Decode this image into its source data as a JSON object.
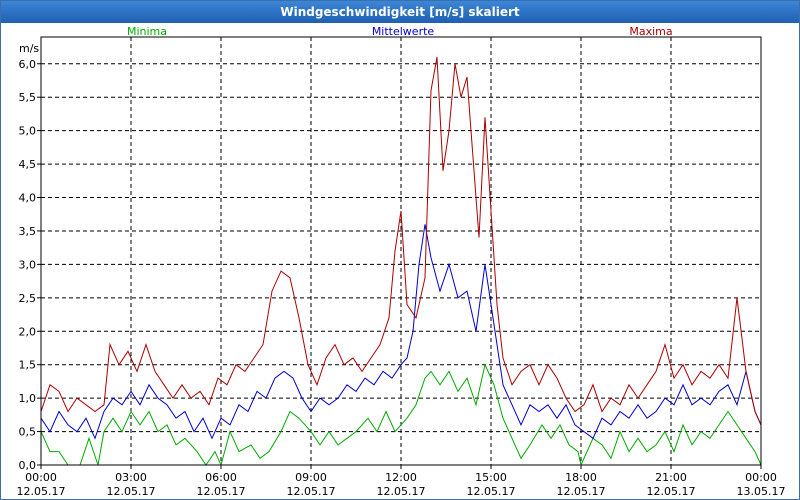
{
  "window": {
    "title": "Windgeschwindigkeit [m/s] skaliert"
  },
  "chart_data": {
    "type": "line",
    "title": "Windgeschwindigkeit [m/s] skaliert",
    "ylabel": "m/s",
    "xlabel": "",
    "ylim": [
      0,
      6.4
    ],
    "xlim": [
      0,
      24
    ],
    "grid": true,
    "legend_position": "top",
    "y_ticks": [
      "0,0",
      "0,5",
      "1,0",
      "1,5",
      "2,0",
      "2,5",
      "3,0",
      "3,5",
      "4,0",
      "4,5",
      "5,0",
      "5,5",
      "6,0"
    ],
    "x_ticks": [
      {
        "time": "00:00",
        "date": "12.05.17"
      },
      {
        "time": "03:00",
        "date": "12.05.17"
      },
      {
        "time": "06:00",
        "date": "12.05.17"
      },
      {
        "time": "09:00",
        "date": "12.05.17"
      },
      {
        "time": "12:00",
        "date": "12.05.17"
      },
      {
        "time": "15:00",
        "date": "12.05.17"
      },
      {
        "time": "18:00",
        "date": "12.05.17"
      },
      {
        "time": "21:00",
        "date": "12.05.17"
      },
      {
        "time": "00:00",
        "date": "13.05.17"
      }
    ],
    "x_unit": "hours since 12.05.17 00:00",
    "series": [
      {
        "name": "Minima",
        "color": "#00aa00",
        "points": [
          [
            0,
            0.5
          ],
          [
            0.3,
            0.2
          ],
          [
            0.6,
            0.2
          ],
          [
            0.9,
            0.0
          ],
          [
            1.3,
            0.0
          ],
          [
            1.6,
            0.4
          ],
          [
            1.9,
            0.0
          ],
          [
            2.1,
            0.5
          ],
          [
            2.4,
            0.7
          ],
          [
            2.7,
            0.5
          ],
          [
            3.0,
            0.8
          ],
          [
            3.3,
            0.6
          ],
          [
            3.6,
            0.8
          ],
          [
            3.9,
            0.5
          ],
          [
            4.2,
            0.6
          ],
          [
            4.5,
            0.3
          ],
          [
            4.8,
            0.4
          ],
          [
            5.2,
            0.2
          ],
          [
            5.5,
            0.0
          ],
          [
            5.8,
            0.2
          ],
          [
            6.0,
            0.0
          ],
          [
            6.3,
            0.5
          ],
          [
            6.6,
            0.2
          ],
          [
            7.0,
            0.3
          ],
          [
            7.3,
            0.1
          ],
          [
            7.6,
            0.2
          ],
          [
            8.0,
            0.5
          ],
          [
            8.3,
            0.8
          ],
          [
            8.6,
            0.7
          ],
          [
            9.0,
            0.5
          ],
          [
            9.3,
            0.3
          ],
          [
            9.6,
            0.5
          ],
          [
            9.9,
            0.3
          ],
          [
            10.2,
            0.4
          ],
          [
            10.5,
            0.5
          ],
          [
            10.9,
            0.7
          ],
          [
            11.2,
            0.5
          ],
          [
            11.5,
            0.8
          ],
          [
            11.8,
            0.5
          ],
          [
            12.2,
            0.7
          ],
          [
            12.5,
            0.9
          ],
          [
            12.8,
            1.3
          ],
          [
            13.0,
            1.4
          ],
          [
            13.3,
            1.2
          ],
          [
            13.6,
            1.4
          ],
          [
            13.9,
            1.1
          ],
          [
            14.2,
            1.3
          ],
          [
            14.5,
            0.9
          ],
          [
            14.8,
            1.5
          ],
          [
            15.1,
            1.2
          ],
          [
            15.4,
            0.7
          ],
          [
            15.7,
            0.4
          ],
          [
            16.0,
            0.1
          ],
          [
            16.3,
            0.3
          ],
          [
            16.7,
            0.6
          ],
          [
            17.0,
            0.4
          ],
          [
            17.3,
            0.6
          ],
          [
            17.6,
            0.3
          ],
          [
            17.9,
            0.2
          ],
          [
            18.0,
            0.0
          ],
          [
            18.4,
            0.4
          ],
          [
            18.7,
            0.3
          ],
          [
            19.0,
            0.1
          ],
          [
            19.3,
            0.5
          ],
          [
            19.6,
            0.2
          ],
          [
            19.9,
            0.4
          ],
          [
            20.2,
            0.2
          ],
          [
            20.5,
            0.3
          ],
          [
            20.8,
            0.5
          ],
          [
            21.1,
            0.2
          ],
          [
            21.4,
            0.6
          ],
          [
            21.7,
            0.3
          ],
          [
            22.0,
            0.5
          ],
          [
            22.3,
            0.4
          ],
          [
            22.6,
            0.6
          ],
          [
            22.9,
            0.8
          ],
          [
            23.2,
            0.6
          ],
          [
            23.5,
            0.4
          ],
          [
            23.8,
            0.2
          ],
          [
            24.0,
            0.0
          ]
        ]
      },
      {
        "name": "Mittelwerte",
        "color": "#0000cc",
        "points": [
          [
            0,
            0.7
          ],
          [
            0.3,
            0.5
          ],
          [
            0.6,
            0.8
          ],
          [
            0.9,
            0.6
          ],
          [
            1.2,
            0.5
          ],
          [
            1.5,
            0.7
          ],
          [
            1.8,
            0.4
          ],
          [
            2.1,
            0.8
          ],
          [
            2.4,
            1.0
          ],
          [
            2.7,
            0.9
          ],
          [
            3.0,
            1.1
          ],
          [
            3.3,
            0.9
          ],
          [
            3.6,
            1.2
          ],
          [
            3.9,
            1.0
          ],
          [
            4.2,
            0.9
          ],
          [
            4.5,
            0.7
          ],
          [
            4.8,
            0.8
          ],
          [
            5.1,
            0.5
          ],
          [
            5.4,
            0.7
          ],
          [
            5.7,
            0.4
          ],
          [
            6.0,
            0.7
          ],
          [
            6.3,
            0.6
          ],
          [
            6.6,
            0.9
          ],
          [
            6.9,
            0.8
          ],
          [
            7.2,
            1.1
          ],
          [
            7.5,
            1.0
          ],
          [
            7.8,
            1.3
          ],
          [
            8.1,
            1.4
          ],
          [
            8.4,
            1.3
          ],
          [
            8.7,
            1.0
          ],
          [
            9.0,
            0.8
          ],
          [
            9.3,
            1.0
          ],
          [
            9.6,
            0.9
          ],
          [
            9.9,
            1.0
          ],
          [
            10.2,
            1.2
          ],
          [
            10.5,
            1.1
          ],
          [
            10.8,
            1.3
          ],
          [
            11.1,
            1.2
          ],
          [
            11.4,
            1.4
          ],
          [
            11.7,
            1.3
          ],
          [
            12.0,
            1.5
          ],
          [
            12.2,
            1.6
          ],
          [
            12.4,
            2.0
          ],
          [
            12.6,
            3.0
          ],
          [
            12.8,
            3.6
          ],
          [
            13.0,
            3.1
          ],
          [
            13.3,
            2.6
          ],
          [
            13.6,
            3.0
          ],
          [
            13.9,
            2.5
          ],
          [
            14.2,
            2.6
          ],
          [
            14.5,
            2.0
          ],
          [
            14.8,
            3.0
          ],
          [
            15.0,
            2.4
          ],
          [
            15.2,
            1.8
          ],
          [
            15.4,
            1.2
          ],
          [
            15.7,
            0.9
          ],
          [
            16.0,
            0.6
          ],
          [
            16.3,
            0.9
          ],
          [
            16.6,
            0.8
          ],
          [
            16.9,
            0.9
          ],
          [
            17.2,
            0.7
          ],
          [
            17.5,
            0.9
          ],
          [
            17.8,
            0.6
          ],
          [
            18.1,
            0.5
          ],
          [
            18.4,
            0.4
          ],
          [
            18.7,
            0.7
          ],
          [
            19.0,
            0.6
          ],
          [
            19.3,
            0.8
          ],
          [
            19.6,
            0.7
          ],
          [
            19.9,
            0.9
          ],
          [
            20.2,
            0.7
          ],
          [
            20.5,
            0.8
          ],
          [
            20.8,
            1.0
          ],
          [
            21.1,
            0.9
          ],
          [
            21.4,
            1.2
          ],
          [
            21.7,
            0.9
          ],
          [
            22.0,
            1.0
          ],
          [
            22.3,
            0.9
          ],
          [
            22.6,
            1.1
          ],
          [
            22.9,
            1.2
          ],
          [
            23.2,
            0.9
          ],
          [
            23.5,
            1.4
          ],
          [
            23.8,
            0.8
          ],
          [
            24.0,
            0.6
          ]
        ]
      },
      {
        "name": "Maxima",
        "color": "#aa0000",
        "points": [
          [
            0,
            0.8
          ],
          [
            0.3,
            1.2
          ],
          [
            0.6,
            1.1
          ],
          [
            0.9,
            0.8
          ],
          [
            1.2,
            1.0
          ],
          [
            1.5,
            0.9
          ],
          [
            1.8,
            0.8
          ],
          [
            2.1,
            0.9
          ],
          [
            2.3,
            1.8
          ],
          [
            2.6,
            1.5
          ],
          [
            2.9,
            1.7
          ],
          [
            3.2,
            1.4
          ],
          [
            3.5,
            1.8
          ],
          [
            3.8,
            1.4
          ],
          [
            4.1,
            1.2
          ],
          [
            4.4,
            1.0
          ],
          [
            4.7,
            1.2
          ],
          [
            5.0,
            1.0
          ],
          [
            5.3,
            1.1
          ],
          [
            5.6,
            0.9
          ],
          [
            5.9,
            1.3
          ],
          [
            6.2,
            1.2
          ],
          [
            6.5,
            1.5
          ],
          [
            6.8,
            1.4
          ],
          [
            7.1,
            1.6
          ],
          [
            7.4,
            1.8
          ],
          [
            7.7,
            2.6
          ],
          [
            8.0,
            2.9
          ],
          [
            8.3,
            2.8
          ],
          [
            8.6,
            2.2
          ],
          [
            8.9,
            1.5
          ],
          [
            9.2,
            1.2
          ],
          [
            9.5,
            1.6
          ],
          [
            9.8,
            1.8
          ],
          [
            10.1,
            1.5
          ],
          [
            10.4,
            1.6
          ],
          [
            10.7,
            1.4
          ],
          [
            11.0,
            1.6
          ],
          [
            11.3,
            1.8
          ],
          [
            11.6,
            2.2
          ],
          [
            11.8,
            3.2
          ],
          [
            12.0,
            3.8
          ],
          [
            12.2,
            2.4
          ],
          [
            12.5,
            2.2
          ],
          [
            12.8,
            2.8
          ],
          [
            13.0,
            5.6
          ],
          [
            13.2,
            6.1
          ],
          [
            13.4,
            4.4
          ],
          [
            13.6,
            5.0
          ],
          [
            13.8,
            6.0
          ],
          [
            14.0,
            5.5
          ],
          [
            14.2,
            5.8
          ],
          [
            14.4,
            4.6
          ],
          [
            14.6,
            3.4
          ],
          [
            14.8,
            5.2
          ],
          [
            15.0,
            3.8
          ],
          [
            15.2,
            2.4
          ],
          [
            15.4,
            1.6
          ],
          [
            15.7,
            1.2
          ],
          [
            16.0,
            1.4
          ],
          [
            16.3,
            1.5
          ],
          [
            16.6,
            1.2
          ],
          [
            16.9,
            1.5
          ],
          [
            17.2,
            1.3
          ],
          [
            17.5,
            1.0
          ],
          [
            17.8,
            0.8
          ],
          [
            18.1,
            0.9
          ],
          [
            18.4,
            1.2
          ],
          [
            18.7,
            0.8
          ],
          [
            19.0,
            1.0
          ],
          [
            19.3,
            0.9
          ],
          [
            19.6,
            1.2
          ],
          [
            19.9,
            1.0
          ],
          [
            20.2,
            1.2
          ],
          [
            20.5,
            1.4
          ],
          [
            20.8,
            1.8
          ],
          [
            21.1,
            1.3
          ],
          [
            21.4,
            1.5
          ],
          [
            21.7,
            1.2
          ],
          [
            22.0,
            1.4
          ],
          [
            22.3,
            1.3
          ],
          [
            22.6,
            1.5
          ],
          [
            22.9,
            1.3
          ],
          [
            23.2,
            2.5
          ],
          [
            23.5,
            1.4
          ],
          [
            23.8,
            0.8
          ],
          [
            24.0,
            0.6
          ]
        ]
      }
    ]
  }
}
